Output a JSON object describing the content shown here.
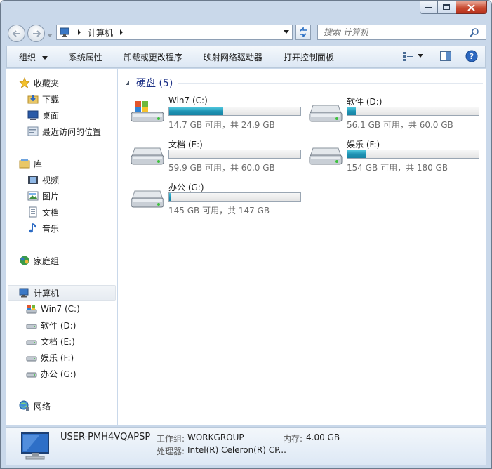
{
  "address": {
    "breadcrumb": "计算机",
    "search_placeholder": "搜索 计算机"
  },
  "toolbar": {
    "organize": "组织",
    "system_properties": "系统属性",
    "uninstall": "卸载或更改程序",
    "map_drive": "映射网络驱动器",
    "control_panel": "打开控制面板"
  },
  "nav": {
    "favorites": "收藏夹",
    "downloads": "下载",
    "desktop": "桌面",
    "recent": "最近访问的位置",
    "libraries": "库",
    "videos": "视频",
    "pictures": "图片",
    "documents": "文档",
    "music": "音乐",
    "homegroup": "家庭组",
    "computer": "计算机",
    "drive_c": "Win7 (C:)",
    "drive_d": "软件 (D:)",
    "drive_e": "文档 (E:)",
    "drive_f": "娱乐 (F:)",
    "drive_g": "办公 (G:)",
    "network": "网络"
  },
  "content": {
    "group_title": "硬盘 (5)",
    "drives": [
      {
        "name": "Win7 (C:)",
        "free_text": "14.7 GB 可用，共 24.9 GB",
        "used_fraction": 0.41
      },
      {
        "name": "软件 (D:)",
        "free_text": "56.1 GB 可用，共 60.0 GB",
        "used_fraction": 0.065
      },
      {
        "name": "文档 (E:)",
        "free_text": "59.9 GB 可用，共 60.0 GB",
        "used_fraction": 0.002
      },
      {
        "name": "娱乐 (F:)",
        "free_text": "154 GB 可用，共 180 GB",
        "used_fraction": 0.14
      },
      {
        "name": "办公 (G:)",
        "free_text": "145 GB 可用，共 147 GB",
        "used_fraction": 0.014
      }
    ]
  },
  "details": {
    "computer_name": "USER-PMH4VQAPSP",
    "workgroup_label": "工作组:",
    "workgroup_value": "WORKGROUP",
    "memory_label": "内存:",
    "memory_value": "4.00 GB",
    "cpu_label": "处理器:",
    "cpu_value": "Intel(R) Celeron(R) CP..."
  },
  "colors": {
    "bar_fill": "#1f93b4",
    "group_title": "#1e3287",
    "close_button": "#c84a30"
  }
}
